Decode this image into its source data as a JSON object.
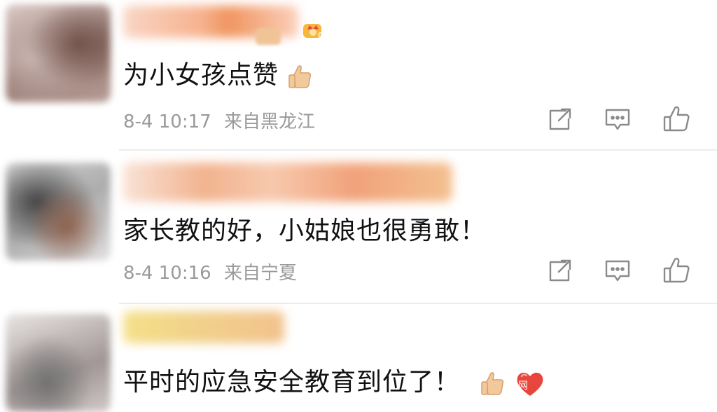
{
  "comments": [
    {
      "text": "为小女孩点赞",
      "date": "8-4 10:17",
      "location": "来自黑龙江",
      "emoji": "thumbs-up"
    },
    {
      "text": "家长教的好，小姑娘也很勇敢！",
      "date": "8-4 10:16",
      "location": "来自宁夏"
    },
    {
      "text": "平时的应急安全教育到位了！",
      "emoji": [
        "thumbs-up",
        "red-heart"
      ],
      "watermark": "网"
    }
  ],
  "icons": {
    "share": "share-icon",
    "reply": "comment-icon",
    "like": "thumbs-up-icon",
    "vip": "crown-badge-icon"
  },
  "colors": {
    "text": "#111111",
    "meta": "#9a9a9a",
    "icon": "#8a8a8a",
    "divider": "#ececec",
    "heart": "#e8453c",
    "thumb": "#f2c99b"
  }
}
